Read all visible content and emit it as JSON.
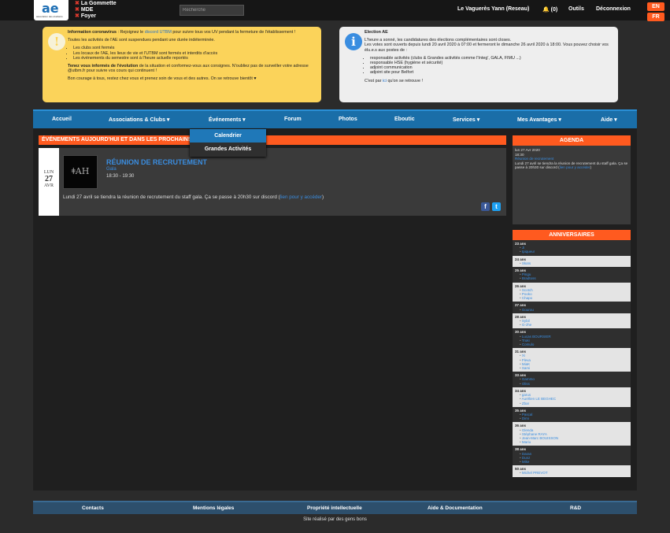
{
  "header": {
    "logo_text": "ae",
    "logo_sub": "association des étudiants",
    "shops": [
      "La Gommette",
      "MDE",
      "Foyer"
    ],
    "search_placeholder": "Recherche",
    "user": "Le Vaguerès Yann (Reseau)",
    "notifications": "(0)",
    "tools": "Outils",
    "logout": "Déconnexion",
    "lang_en": "EN",
    "lang_fr": "FR"
  },
  "covid": {
    "title": "Information coronavirus",
    "p1_a": " : Rejoignez le ",
    "p1_link": "discord UTBM",
    "p1_b": " pour suivre tous vos UV pendant la fermeture de l'établissement !",
    "p2": "Toutes les activités de l'AE sont suspendues pendant une durée indéterminée.",
    "items": [
      "Les clubs sont fermés",
      "Les locaux de l'AE, les lieux de vie et l'UTBM sont fermés et interdits d'accès",
      "Les événements du semestre sont à l'heure actuelle reportés"
    ],
    "p3_bold": "Tenez vous informés de l'évolution",
    "p3": " de la situation et conformez-vous aux consignes. N'oubliez pas de surveiller votre adresse @utbm.fr pour suivre vos cours qui continuent !",
    "p4": "Bon courage à tous, restez chez vous et prenez soin de vous et des autres. On se retrouve bientôt ♥"
  },
  "election": {
    "title": "Election AE",
    "p1": "L'heure a sonné, les candidatures des élections complémentaires sont closes.",
    "p2": "Les votes sont ouverts depuis lundi 20 avril 2020 à 07:00 et fermeront le dimanche 26 avril 2020 à 18:00. Vous pouvez choisir vos élu.e.s aux postes de :",
    "items": [
      "responsable activités (clubs & Grandes activités comme l'Integ', GALA, FIMU ...)",
      "responsable HSE (hygiène et sécurité)",
      "adjoint communication",
      "adjoint site pour Belfort"
    ],
    "p3_a": "C'est par ",
    "p3_link": "ici",
    "p3_b": " qu'on se retrouve !"
  },
  "nav": {
    "items": [
      "Accueil",
      "Associations & Clubs ▾",
      "Événements ▾",
      "Forum",
      "Photos",
      "Eboutic",
      "Services ▾",
      "Mes Avantages ▾",
      "Aide ▾"
    ],
    "dropdown": [
      "Calendrier",
      "Grandes Activités"
    ]
  },
  "events": {
    "header": "ÉVÉNEMENTS AUJOURD'HUI ET DANS LES PROCHAINS JOURS",
    "day_name": "LUN",
    "day_num": "27",
    "month": "AVR",
    "thumb": "ǂAH",
    "title": "RÉUNION DE RECRUTEMENT",
    "club": "Gala",
    "time": "18:30 - 19:30",
    "desc_a": "Lundi 27 avril se tiendra la réunion de recrutement du staff gala. Ça se passe à 20h30 sur discord (",
    "desc_link": "lien pour y accéder",
    "desc_b": ")"
  },
  "agenda": {
    "header": "AGENDA",
    "date": "lun 27 Avr 2020",
    "time": "18:30",
    "title": "Réunion de recrutement",
    "text_a": "Lundi 27 avril se tiendra la réunion de recrutement du staff gala. Ça se passe à 20h30 sur discord (",
    "text_link": "lien pour y accéder",
    "text_b": ")"
  },
  "birthdays": {
    "header": "ANNIVERSAIRES",
    "groups": [
      {
        "age": "23 ans",
        "names": [
          "Ji",
          "Ipiqueur"
        ]
      },
      {
        "age": "24 ans",
        "names": [
          "Skaïs"
        ]
      },
      {
        "age": "25 ans",
        "names": [
          "Pingu",
          "Bradtoss"
        ]
      },
      {
        "age": "26 ans",
        "names": [
          "Scotch",
          "Pooko",
          "Chapo"
        ]
      },
      {
        "age": "27 ans",
        "names": [
          "Gourou"
        ]
      },
      {
        "age": "28 ans",
        "names": [
          "Sybil",
          "G-zhe"
        ]
      },
      {
        "age": "30 ans",
        "names": [
          "Lucas BOURSIER",
          "Truki",
          "Comulo"
        ]
      },
      {
        "age": "31 ans",
        "names": [
          "Xi",
          "Fleva",
          "MiaK",
          "Sami"
        ]
      },
      {
        "age": "33 ans",
        "names": [
          "Gammo",
          "Oliss"
        ]
      },
      {
        "age": "34 ans",
        "names": [
          "garus",
          "Aurélien LE BEGHEC",
          "Zbar"
        ]
      },
      {
        "age": "35 ans",
        "names": [
          "Pascal",
          "Dimi"
        ]
      },
      {
        "age": "36 ans",
        "names": [
          "Glenda",
          "Stéphane RAYA",
          "Jean-Marc BOUISSON",
          "Mariu"
        ]
      },
      {
        "age": "38 ans",
        "names": [
          "Daran",
          "Dunz",
          "Mike"
        ]
      },
      {
        "age": "50 ans",
        "names": [
          "Michel PREVOT"
        ]
      }
    ]
  },
  "footer": {
    "links": [
      "Contacts",
      "Mentions légales",
      "Propriété intellectuelle",
      "Aide & Documentation",
      "R&D"
    ],
    "credit": "Site réalisé par des gens bons"
  }
}
